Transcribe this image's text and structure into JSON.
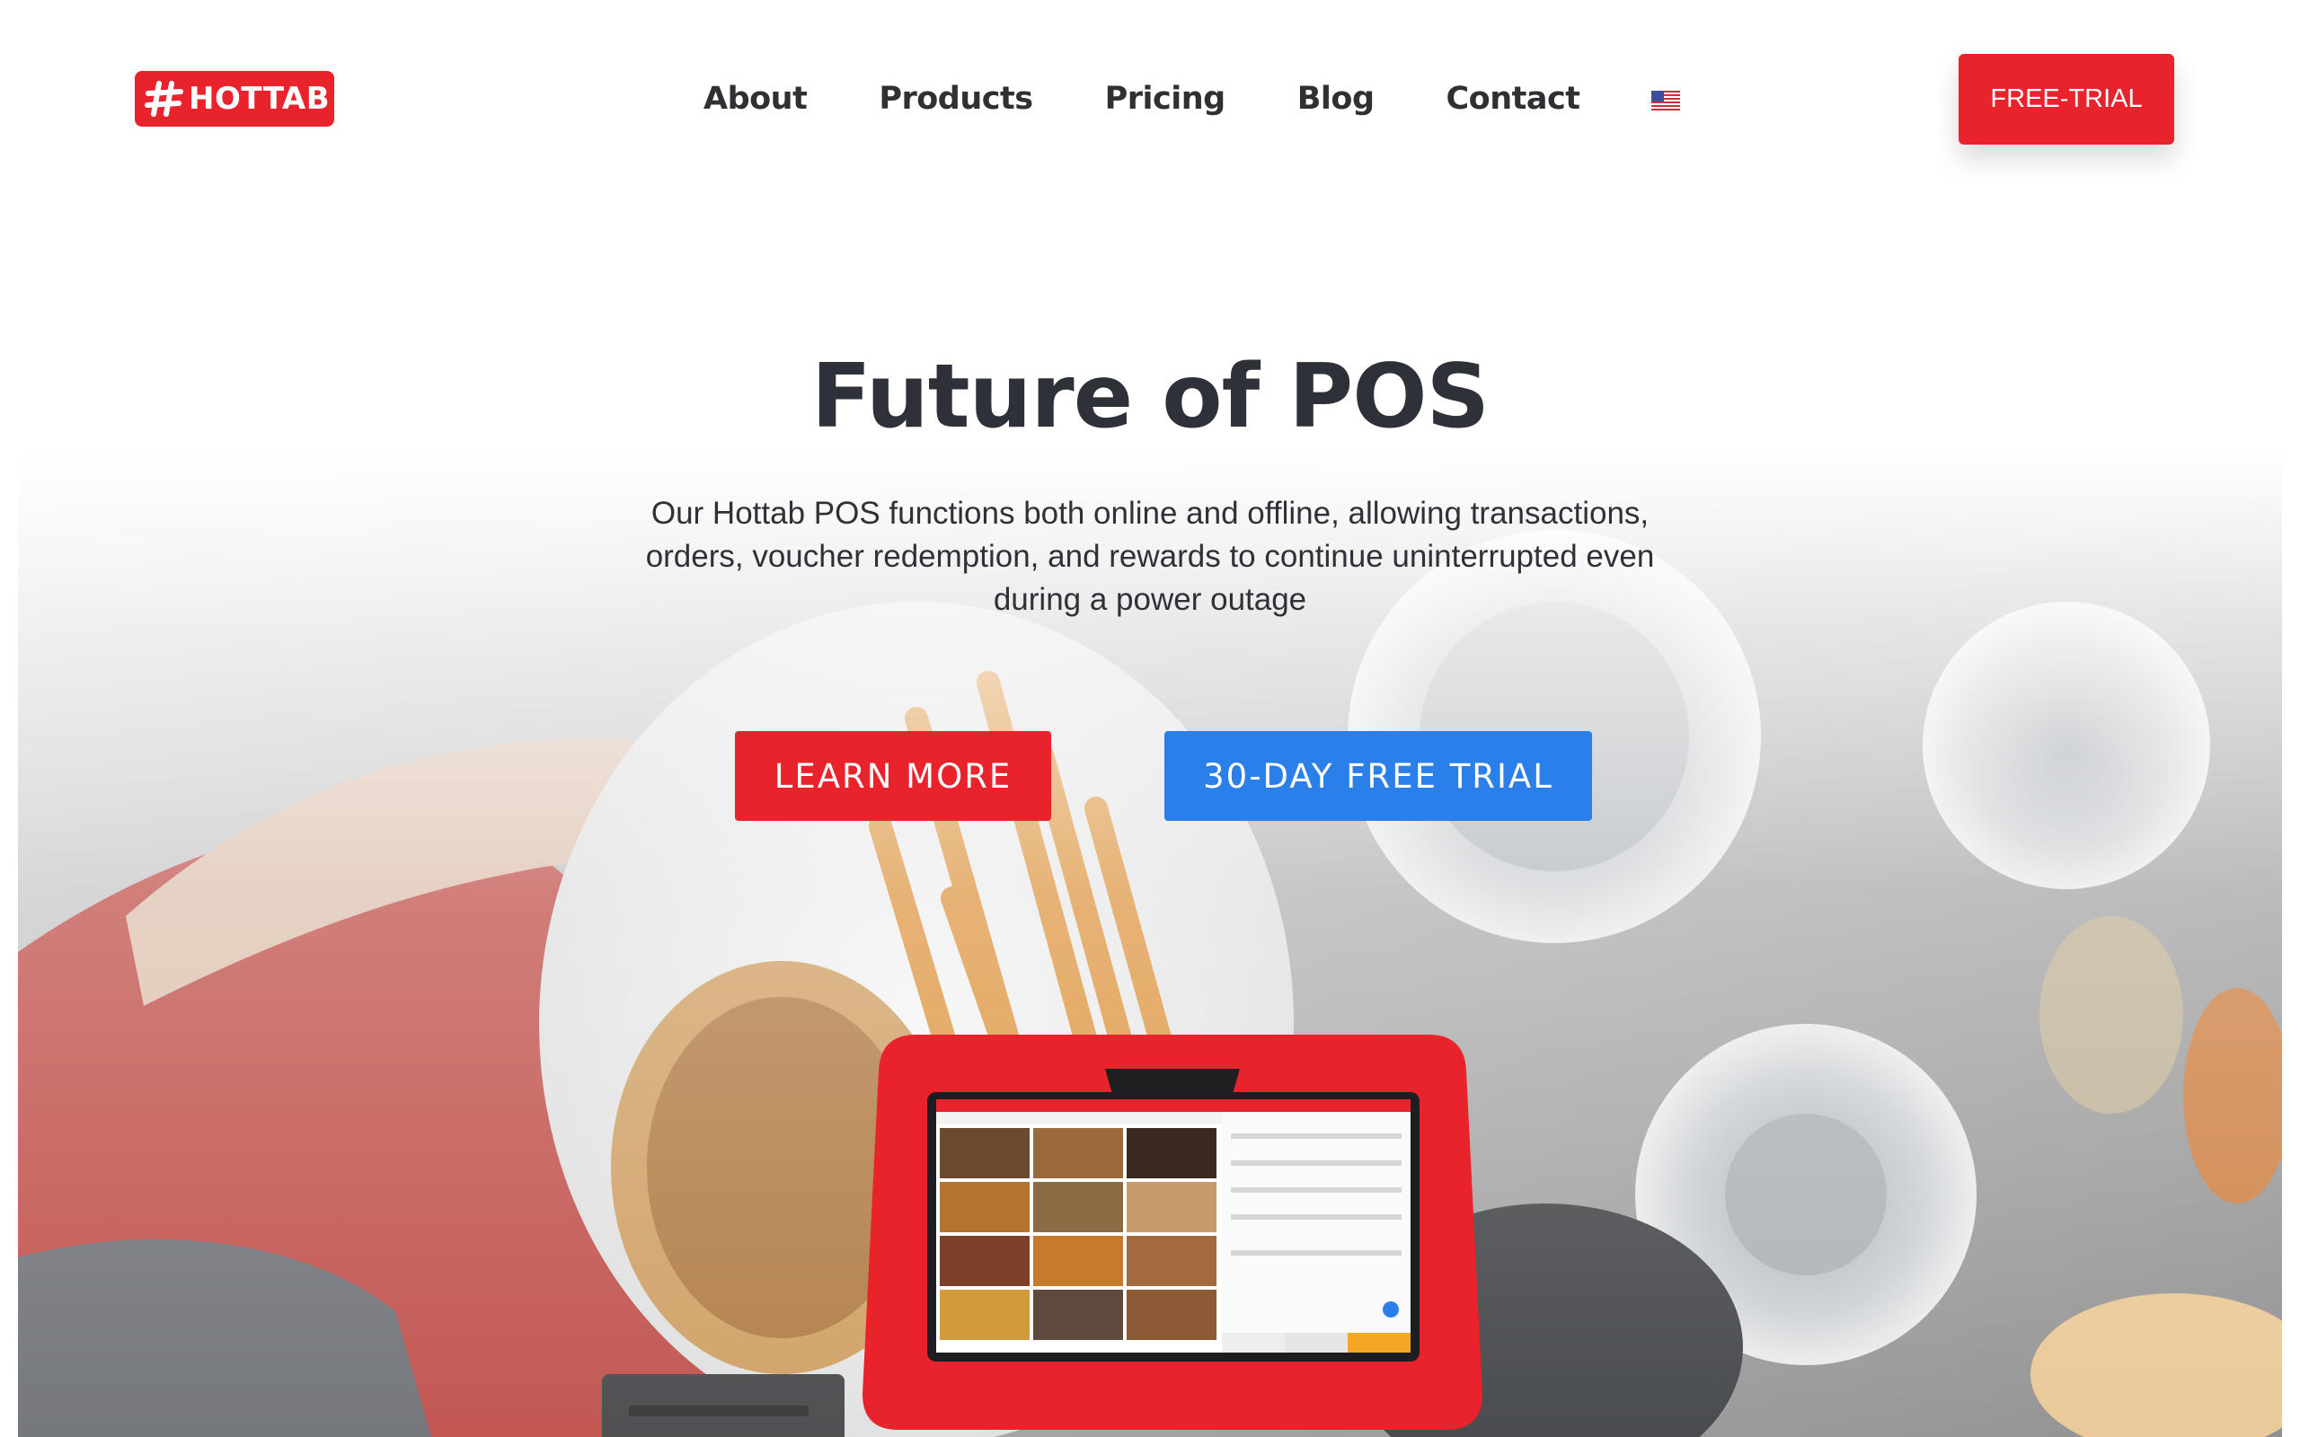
{
  "brand": {
    "name": "HOTTAB",
    "color": "#e8232b"
  },
  "nav": {
    "items": [
      {
        "label": "About"
      },
      {
        "label": "Products"
      },
      {
        "label": "Pricing"
      },
      {
        "label": "Blog"
      },
      {
        "label": "Contact"
      }
    ],
    "language_icon": "us-flag-icon"
  },
  "header_cta": {
    "label": "FREE-TRIAL"
  },
  "hero": {
    "title": "Future of POS",
    "subtitle": "Our Hottab POS functions both online and offline, allowing transactions, orders, voucher redemption, and rewards to continue uninterrupted even during a power outage",
    "learn_more_label": "LEARN MORE",
    "trial_label": "30-DAY FREE TRIAL"
  },
  "colors": {
    "primary_red": "#e8232b",
    "primary_blue": "#2a80e8",
    "text_dark": "#2f3138"
  }
}
